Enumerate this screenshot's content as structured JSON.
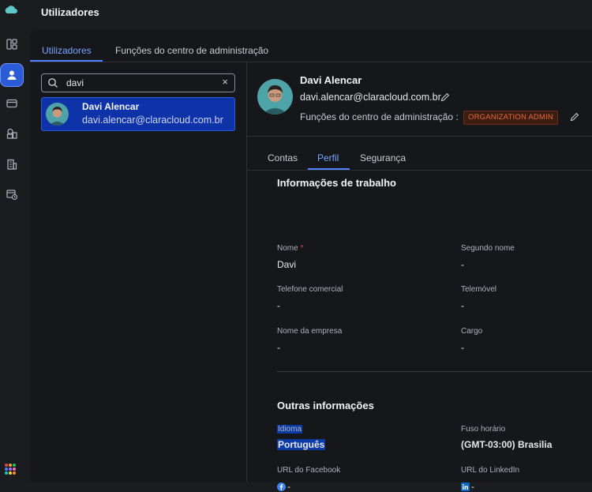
{
  "colors": {
    "accent": "#4f84ff",
    "selected_bg": "#0e33a8",
    "badge_text": "#e8693c"
  },
  "rail": {
    "items": [
      {
        "icon": "layout-icon"
      },
      {
        "icon": "user-icon",
        "active": true
      },
      {
        "icon": "card-icon"
      },
      {
        "icon": "apps-shapes-icon"
      },
      {
        "icon": "building-icon"
      },
      {
        "icon": "calendar-clock-icon"
      }
    ],
    "apps_icon": "app-grid-icon"
  },
  "header": {
    "title": "Utilizadores"
  },
  "tabs": [
    {
      "label": "Utilizadores",
      "active": true
    },
    {
      "label": "Funções do centro de administração",
      "active": false
    }
  ],
  "search": {
    "value": "davi",
    "clear": "×"
  },
  "results": [
    {
      "name": "Davi Alencar",
      "email": "davi.alencar@claracloud.com.br"
    }
  ],
  "profile": {
    "name": "Davi Alencar",
    "email": "davi.alencar@claracloud.com.br",
    "roles_label": "Funções do centro de administração :",
    "role_badge": "ORGANIZATION ADMIN"
  },
  "subtabs": [
    {
      "label": "Contas",
      "active": false
    },
    {
      "label": "Perfil",
      "active": true
    },
    {
      "label": "Segurança",
      "active": false
    }
  ],
  "work_info": {
    "title": "Informações de trabalho",
    "fields": [
      {
        "label": "Nome",
        "value": "Davi",
        "required": "*"
      },
      {
        "label": "Segundo nome",
        "value": "-"
      },
      {
        "label": "Telefone comercial",
        "value": "-"
      },
      {
        "label": "Telemóvel",
        "value": "-"
      },
      {
        "label": "Nome da empresa",
        "value": "-"
      },
      {
        "label": "Cargo",
        "value": "-"
      }
    ]
  },
  "other_info": {
    "title": "Outras informações",
    "fields": [
      {
        "label": "Idioma",
        "value": "Português"
      },
      {
        "label": "Fuso horário",
        "value": "(GMT-03:00) Brasilia"
      },
      {
        "label": "URL do Facebook",
        "value": "-",
        "icon": "facebook-icon"
      },
      {
        "label": "URL do LinkedIn",
        "value": "-",
        "icon": "linkedin-icon"
      }
    ]
  }
}
